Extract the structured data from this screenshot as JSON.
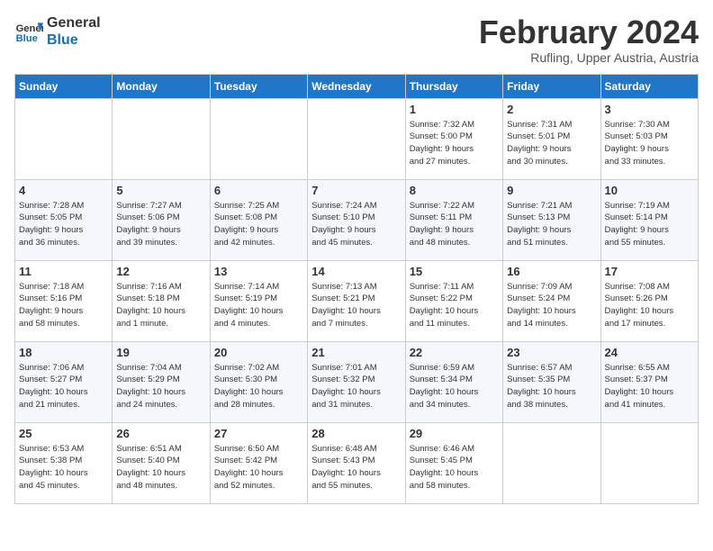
{
  "logo": {
    "line1": "General",
    "line2": "Blue"
  },
  "title": "February 2024",
  "subtitle": "Rufling, Upper Austria, Austria",
  "weekdays": [
    "Sunday",
    "Monday",
    "Tuesday",
    "Wednesday",
    "Thursday",
    "Friday",
    "Saturday"
  ],
  "weeks": [
    [
      {
        "day": "",
        "info": ""
      },
      {
        "day": "",
        "info": ""
      },
      {
        "day": "",
        "info": ""
      },
      {
        "day": "",
        "info": ""
      },
      {
        "day": "1",
        "info": "Sunrise: 7:32 AM\nSunset: 5:00 PM\nDaylight: 9 hours\nand 27 minutes."
      },
      {
        "day": "2",
        "info": "Sunrise: 7:31 AM\nSunset: 5:01 PM\nDaylight: 9 hours\nand 30 minutes."
      },
      {
        "day": "3",
        "info": "Sunrise: 7:30 AM\nSunset: 5:03 PM\nDaylight: 9 hours\nand 33 minutes."
      }
    ],
    [
      {
        "day": "4",
        "info": "Sunrise: 7:28 AM\nSunset: 5:05 PM\nDaylight: 9 hours\nand 36 minutes."
      },
      {
        "day": "5",
        "info": "Sunrise: 7:27 AM\nSunset: 5:06 PM\nDaylight: 9 hours\nand 39 minutes."
      },
      {
        "day": "6",
        "info": "Sunrise: 7:25 AM\nSunset: 5:08 PM\nDaylight: 9 hours\nand 42 minutes."
      },
      {
        "day": "7",
        "info": "Sunrise: 7:24 AM\nSunset: 5:10 PM\nDaylight: 9 hours\nand 45 minutes."
      },
      {
        "day": "8",
        "info": "Sunrise: 7:22 AM\nSunset: 5:11 PM\nDaylight: 9 hours\nand 48 minutes."
      },
      {
        "day": "9",
        "info": "Sunrise: 7:21 AM\nSunset: 5:13 PM\nDaylight: 9 hours\nand 51 minutes."
      },
      {
        "day": "10",
        "info": "Sunrise: 7:19 AM\nSunset: 5:14 PM\nDaylight: 9 hours\nand 55 minutes."
      }
    ],
    [
      {
        "day": "11",
        "info": "Sunrise: 7:18 AM\nSunset: 5:16 PM\nDaylight: 9 hours\nand 58 minutes."
      },
      {
        "day": "12",
        "info": "Sunrise: 7:16 AM\nSunset: 5:18 PM\nDaylight: 10 hours\nand 1 minute."
      },
      {
        "day": "13",
        "info": "Sunrise: 7:14 AM\nSunset: 5:19 PM\nDaylight: 10 hours\nand 4 minutes."
      },
      {
        "day": "14",
        "info": "Sunrise: 7:13 AM\nSunset: 5:21 PM\nDaylight: 10 hours\nand 7 minutes."
      },
      {
        "day": "15",
        "info": "Sunrise: 7:11 AM\nSunset: 5:22 PM\nDaylight: 10 hours\nand 11 minutes."
      },
      {
        "day": "16",
        "info": "Sunrise: 7:09 AM\nSunset: 5:24 PM\nDaylight: 10 hours\nand 14 minutes."
      },
      {
        "day": "17",
        "info": "Sunrise: 7:08 AM\nSunset: 5:26 PM\nDaylight: 10 hours\nand 17 minutes."
      }
    ],
    [
      {
        "day": "18",
        "info": "Sunrise: 7:06 AM\nSunset: 5:27 PM\nDaylight: 10 hours\nand 21 minutes."
      },
      {
        "day": "19",
        "info": "Sunrise: 7:04 AM\nSunset: 5:29 PM\nDaylight: 10 hours\nand 24 minutes."
      },
      {
        "day": "20",
        "info": "Sunrise: 7:02 AM\nSunset: 5:30 PM\nDaylight: 10 hours\nand 28 minutes."
      },
      {
        "day": "21",
        "info": "Sunrise: 7:01 AM\nSunset: 5:32 PM\nDaylight: 10 hours\nand 31 minutes."
      },
      {
        "day": "22",
        "info": "Sunrise: 6:59 AM\nSunset: 5:34 PM\nDaylight: 10 hours\nand 34 minutes."
      },
      {
        "day": "23",
        "info": "Sunrise: 6:57 AM\nSunset: 5:35 PM\nDaylight: 10 hours\nand 38 minutes."
      },
      {
        "day": "24",
        "info": "Sunrise: 6:55 AM\nSunset: 5:37 PM\nDaylight: 10 hours\nand 41 minutes."
      }
    ],
    [
      {
        "day": "25",
        "info": "Sunrise: 6:53 AM\nSunset: 5:38 PM\nDaylight: 10 hours\nand 45 minutes."
      },
      {
        "day": "26",
        "info": "Sunrise: 6:51 AM\nSunset: 5:40 PM\nDaylight: 10 hours\nand 48 minutes."
      },
      {
        "day": "27",
        "info": "Sunrise: 6:50 AM\nSunset: 5:42 PM\nDaylight: 10 hours\nand 52 minutes."
      },
      {
        "day": "28",
        "info": "Sunrise: 6:48 AM\nSunset: 5:43 PM\nDaylight: 10 hours\nand 55 minutes."
      },
      {
        "day": "29",
        "info": "Sunrise: 6:46 AM\nSunset: 5:45 PM\nDaylight: 10 hours\nand 58 minutes."
      },
      {
        "day": "",
        "info": ""
      },
      {
        "day": "",
        "info": ""
      }
    ]
  ]
}
